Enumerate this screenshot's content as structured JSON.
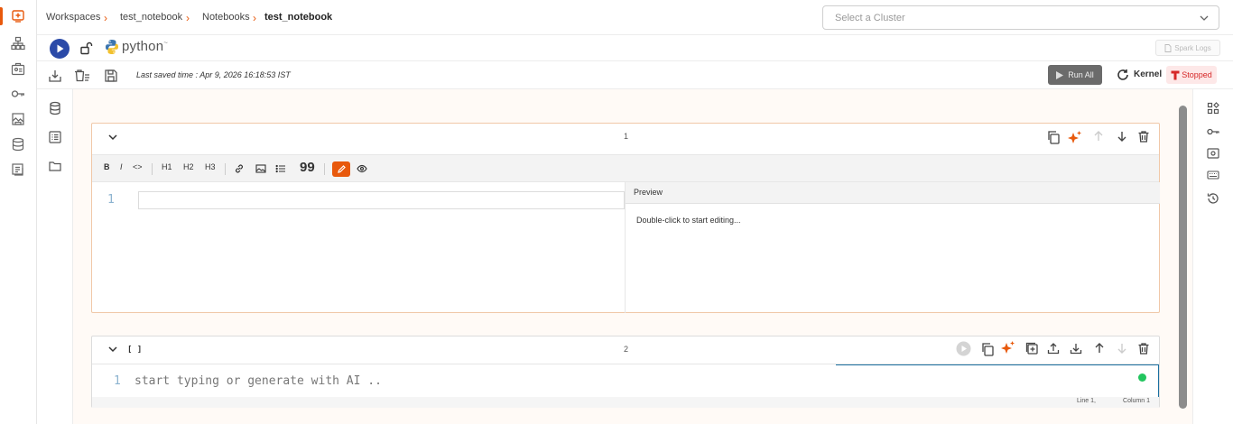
{
  "breadcrumb": [
    "Workspaces",
    "test_notebook",
    "Notebooks",
    "test_notebook"
  ],
  "cluster_select": {
    "placeholder": "Select a Cluster"
  },
  "language": {
    "name": "python",
    "superscript": "~"
  },
  "spark_logs_label": "Spark Logs",
  "toolbar": {
    "last_saved": "Last saved time : Apr 9, 2026 16:18:53 IST",
    "run_all_label": "Run All",
    "kernel_label": "Kernel",
    "kernel_status": "Stopped"
  },
  "colors": {
    "accent": "#e8590c",
    "run_button": "#2b4aa8",
    "stopped": "#d62828",
    "status_ok": "#22c55e"
  },
  "cell1": {
    "number": "1",
    "type": "markdown",
    "md_toolbar": [
      "B",
      "I",
      "<>",
      "H1",
      "H2",
      "H3",
      "link",
      "image",
      "list",
      "99",
      "edit",
      "preview"
    ],
    "gutter": "1",
    "preview_title": "Preview",
    "preview_hint": "Double-click to start editing..."
  },
  "cell2": {
    "number": "2",
    "exec_count": "[ ]",
    "gutter": "1",
    "placeholder": "start typing or generate with AI ..",
    "status_line": "Line 1,",
    "status_col": "Column 1"
  }
}
